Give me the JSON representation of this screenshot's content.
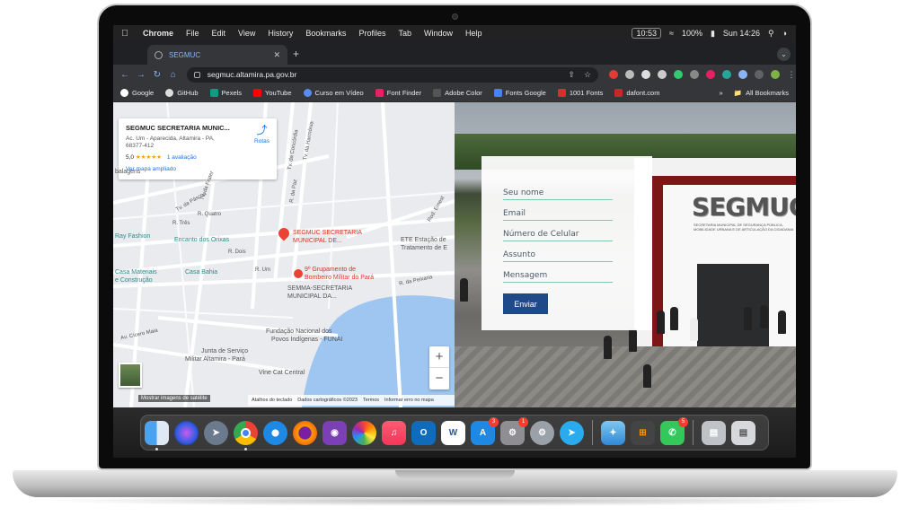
{
  "menubar": {
    "app_name": "Chrome",
    "items": [
      "File",
      "Edit",
      "View",
      "History",
      "Bookmarks",
      "Profiles",
      "Tab",
      "Window",
      "Help"
    ],
    "time_box": "10:53",
    "battery": "100%",
    "datetime": "Sun 14:26"
  },
  "browser": {
    "tab_title": "SEGMUC",
    "url": "segmuc.altamira.pa.gov.br",
    "bookmarks": [
      "Google",
      "GitHub",
      "Pexels",
      "YouTube",
      "Curso em Vídeo",
      "Font Finder",
      "Adobe Color",
      "Fonts Google",
      "1001 Fonts",
      "dafont.com"
    ],
    "all_bookmarks": "All Bookmarks"
  },
  "map": {
    "card": {
      "name": "SEGMUC SECRETARIA MUNIC...",
      "address": "Ac. Um - Aparecida, Altamira - PA, 68377-412",
      "rating": "5,0",
      "stars": "★★★★★",
      "reviews": "1 avaliação",
      "larger_map": "Ver mapa ampliado",
      "directions": "Rotas"
    },
    "labels": {
      "segmuc": "SEGMUC SECRETARIA",
      "segmuc2": "MUNICIPAL DE...",
      "bombeiro1": "9º Grupamento de",
      "bombeiro2": "Bombeiro Militar do Pará",
      "semma1": "SEMMA-SECRETARIA",
      "semma2": "MUNICIPAL DA...",
      "encanto": "Encanto dos Orixas",
      "casabahia": "Casa Bahia",
      "rayfashion": "Ray Fashion",
      "casamat1": "Casa Materiais",
      "casamat2": "e Construção",
      "ete1": "ETE Estação de",
      "ete2": "Tratamento de E",
      "funai1": "Fundação Nacional dos",
      "funai2": "Povos Indígenas - FUNAI",
      "junta1": "Junta de Serviço",
      "junta2": "Militar Altamira - Pará",
      "vinecat": "Vine Cat Central",
      "tv_harmonia": "Tv. da Harmônia",
      "tv_concordia": "Tv. da Concórdia",
      "tv_paz": "R. da Paz",
      "tv_fraternidade": "Tv. da Frater",
      "tv_pascoa": "Tv. da Páscoa",
      "r_quatro": "R. Quatro",
      "r_tres": "R. Três",
      "r_dois": "R. Dois",
      "r_um": "R. Um",
      "r_peixaria": "R. da Peixaria",
      "r_cicero": "Av. Cícero Maia",
      "r_ernest": "Rod. Ernest",
      "balagens": "balagens"
    },
    "zoom_in": "+",
    "zoom_out": "−",
    "satellite": "Mostrar imagens de satélite",
    "attribution": [
      "Atalhos do teclado",
      "Dados cartográficos ©2023",
      "Termos",
      "Informar erro no mapa"
    ]
  },
  "photo": {
    "logo": "SEGMUC",
    "logo_sub": "SECRETARIA MUNICIPAL DE SEGURANÇA PÚBLICA, MOBILIDADE URBANA E DE ARTICULAÇÃO DA CIDADANIA"
  },
  "form": {
    "name_placeholder": "Seu nome",
    "email_placeholder": "Email",
    "phone_placeholder": "Número de Celular",
    "subject_placeholder": "Assunto",
    "message_placeholder": "Mensagem",
    "submit": "Enviar"
  },
  "dock": {
    "badges": {
      "appstore": "3",
      "settings": "1",
      "facetime": "5"
    },
    "icons": [
      "finder-icon",
      "siri-icon",
      "launchpad-icon",
      "chrome-icon",
      "safari-icon",
      "firefox-icon",
      "github-desktop-icon",
      "photos-icon",
      "music-icon",
      "outlook-icon",
      "word-icon",
      "app-store-icon",
      "system-preferences-icon",
      "utilities-icon",
      "telegram-icon",
      "swift-icon",
      "calculator-icon",
      "facetime-icon",
      "downloads-icon",
      "trash-icon"
    ],
    "word_label": "W",
    "outlook_label": "O"
  }
}
